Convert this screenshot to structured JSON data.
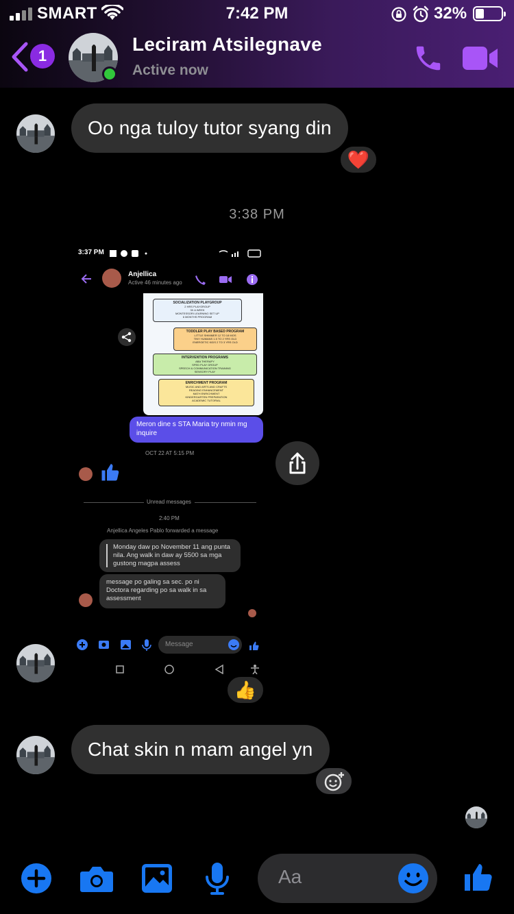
{
  "status_bar": {
    "carrier": "SMART",
    "time": "7:42 PM",
    "battery_percent": "32%",
    "battery_level": 0.32,
    "icons": [
      "signal-icon",
      "wifi-icon",
      "orientation-lock-icon",
      "alarm-icon",
      "battery-icon"
    ]
  },
  "header": {
    "unread_count": "1",
    "contact_name": "Leciram Atsilegnave",
    "status": "Active now",
    "accent_color": "#a855f7",
    "icons": [
      "back-icon",
      "phone-icon",
      "video-icon"
    ]
  },
  "messages": [
    {
      "type": "text",
      "text": "Oo nga tuloy tutor syang din",
      "reaction": "❤️"
    },
    {
      "type": "timestamp",
      "text": "3:38 PM"
    },
    {
      "type": "image",
      "reaction": "👍"
    },
    {
      "type": "text",
      "text": "Chat skin n mam angel yn"
    }
  ],
  "shared_screenshot": {
    "time": "3:37 PM",
    "contact_name": "Anjellica",
    "contact_status": "Active 46 minutes ago",
    "poster_sections": [
      {
        "title": "SOCIALIZATION PLAYGROUP",
        "lines": [
          "2 HRS PLAYGROUP",
          "3X A WEEK",
          "MONTESSORI LEARNING SET UP",
          "6 MONTHS PROGRAM"
        ]
      },
      {
        "title": "TODDLER PLAY BASED PROGRAM",
        "lines": [
          "LITTLE SHIMMER 12 TO 18 MOS",
          "TINY HUMANS 1.5 TO 2 YRS OLD",
          "ENERGETIC KIDS 2 TO 3 YRS OLD"
        ]
      },
      {
        "title": "INTERVENTION PROGRAMS",
        "lines": [
          "ABA THERAPY",
          "SPED PLAY GROUP",
          "SPEECH & COMMUNICATION TRAINING",
          "SENSORY PLAY"
        ]
      },
      {
        "title": "ENRICHMENT PROGRAM",
        "lines": [
          "MUSIC AND ARTS AND CRAFTS",
          "READING ENHANCEMENT",
          "MATH ENRICHMENT",
          "KINDERGARTEN PREPARATION",
          "ACADEMIC TUTORIAL"
        ]
      }
    ],
    "sent_message": "Meron dine s STA Maria try nmin mg inquire",
    "date_label": "OCT 22 AT 5:15 PM",
    "unread_label": "Unread messages",
    "time2": "2:40 PM",
    "forward_label": "Anjellica Angeles Pablo forwarded a message",
    "forwarded_text": "Monday daw po November 11 ang punta nila. Ang walk in daw ay 5500 sa mga gustong magpa assess",
    "reply_text": "message po galing sa sec. po ni Doctora regarding po sa walk in sa assessment",
    "composer_placeholder": "Message"
  },
  "composer": {
    "placeholder": "Aa",
    "accent_color": "#1877f2",
    "icons": [
      "plus-icon",
      "camera-icon",
      "gallery-icon",
      "microphone-icon",
      "emoji-icon",
      "thumbs-up-icon"
    ]
  }
}
